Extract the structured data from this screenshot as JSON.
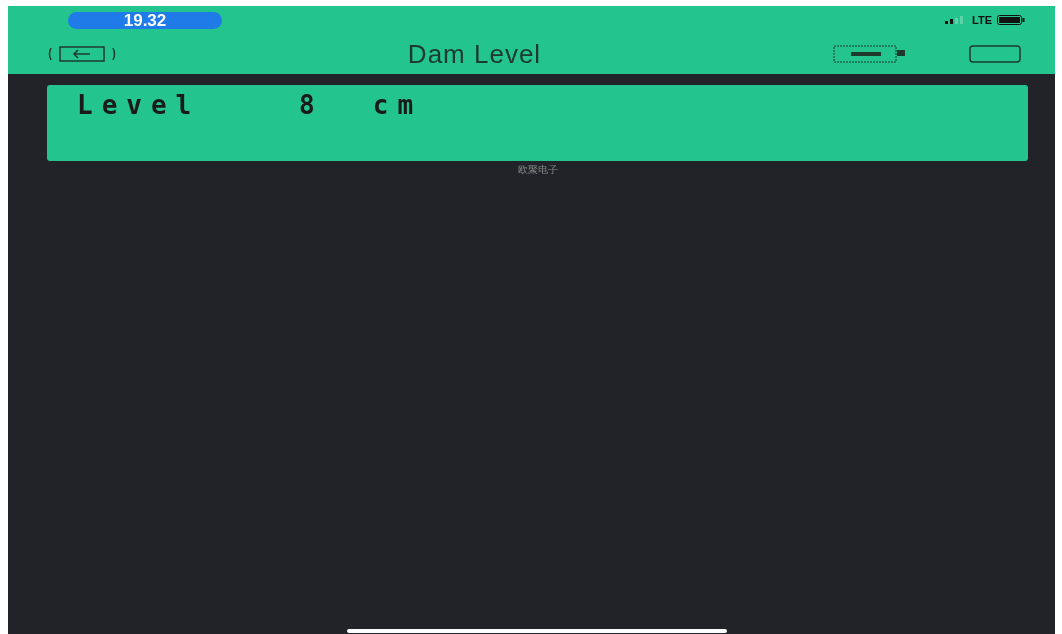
{
  "status_bar": {
    "time": "19.32",
    "network": "LTE"
  },
  "nav_bar": {
    "title": "Dam Level"
  },
  "lcd": {
    "line_1": "Level    8  cm",
    "caption": "欧聚电子"
  }
}
